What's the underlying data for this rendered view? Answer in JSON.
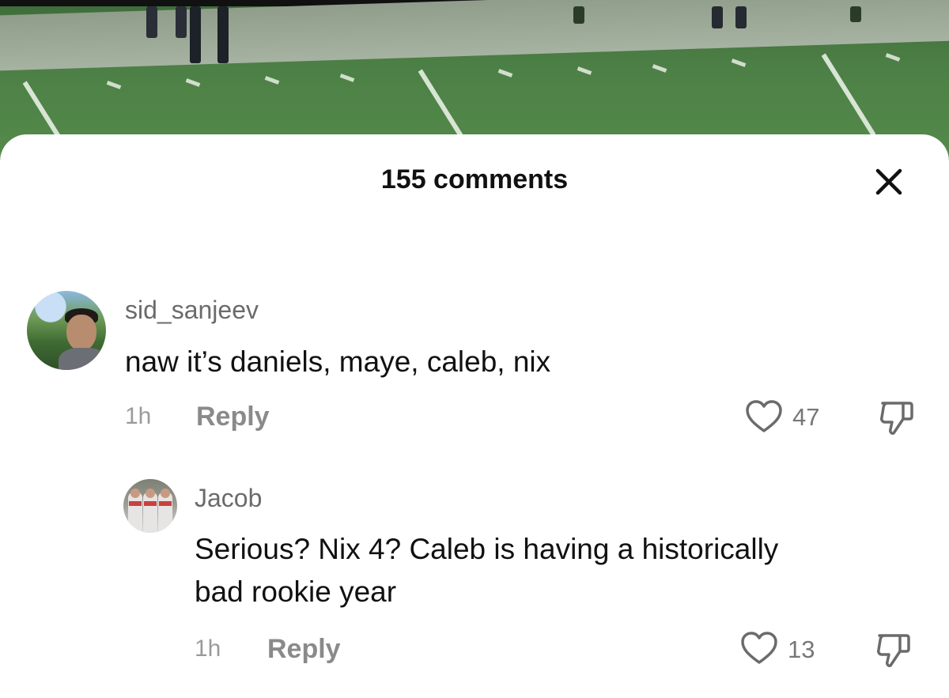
{
  "comments_header": {
    "count_label": "155 comments"
  },
  "comments": [
    {
      "username": "sid_sanjeev",
      "text": "naw it’s daniels, maye, caleb, nix",
      "time": "1h",
      "reply_label": "Reply",
      "likes": "47"
    },
    {
      "username": "Jacob",
      "text_line1": "Serious? Nix 4? Caleb is having a historically",
      "text_line2": "bad rookie year",
      "time": "1h",
      "reply_label": "Reply",
      "likes": "13"
    }
  ],
  "icons": {
    "close": "close-icon",
    "like": "heart-outline-icon",
    "dislike": "thumbs-down-icon"
  },
  "colors": {
    "sheet_bg": "#ffffff",
    "field_green": "#4c7f45",
    "secondary_text": "#8a8a8a"
  }
}
